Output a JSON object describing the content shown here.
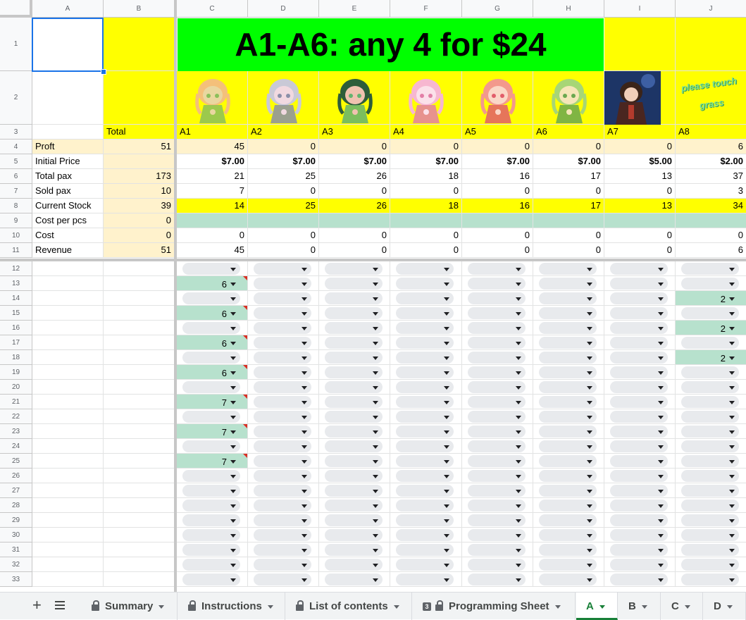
{
  "columns": [
    "A",
    "B",
    "C",
    "D",
    "E",
    "F",
    "G",
    "H",
    "I",
    "J"
  ],
  "banner": "A1-A6: any 4 for $24",
  "header_row": {
    "total": "Total",
    "items": [
      "A1",
      "A2",
      "A3",
      "A4",
      "A5",
      "A6",
      "A7",
      "A8"
    ]
  },
  "rows": [
    {
      "num": "4",
      "label": "Proft",
      "total": "51",
      "values": [
        "45",
        "0",
        "0",
        "0",
        "0",
        "0",
        "0",
        "6"
      ]
    },
    {
      "num": "5",
      "label": "Initial Price",
      "total": "",
      "values": [
        "$7.00",
        "$7.00",
        "$7.00",
        "$7.00",
        "$7.00",
        "$7.00",
        "$5.00",
        "$2.00"
      ]
    },
    {
      "num": "6",
      "label": "Total pax",
      "total": "173",
      "values": [
        "21",
        "25",
        "26",
        "18",
        "16",
        "17",
        "13",
        "37"
      ]
    },
    {
      "num": "7",
      "label": "Sold pax",
      "total": "10",
      "values": [
        "7",
        "0",
        "0",
        "0",
        "0",
        "0",
        "0",
        "3"
      ]
    },
    {
      "num": "8",
      "label": "Current Stock",
      "total": "39",
      "values": [
        "14",
        "25",
        "26",
        "18",
        "16",
        "17",
        "13",
        "34"
      ]
    },
    {
      "num": "9",
      "label": "Cost per pcs",
      "total": "0",
      "values": [
        "",
        "",
        "",
        "",
        "",
        "",
        "",
        ""
      ]
    },
    {
      "num": "10",
      "label": "Cost",
      "total": "0",
      "values": [
        "0",
        "0",
        "0",
        "0",
        "0",
        "0",
        "0",
        "0"
      ]
    },
    {
      "num": "11",
      "label": "Revenue",
      "total": "51",
      "values": [
        "45",
        "0",
        "0",
        "0",
        "0",
        "0",
        "0",
        "6"
      ]
    }
  ],
  "row_numbers_top": [
    "1",
    "2",
    "3"
  ],
  "dropdown_rows": [
    "12",
    "13",
    "14",
    "15",
    "16",
    "17",
    "18",
    "19",
    "20",
    "21",
    "22",
    "23",
    "24",
    "25",
    "26",
    "27",
    "28",
    "29",
    "30",
    "31",
    "32",
    "33"
  ],
  "dropdown_values": {
    "C": {
      "13": "6",
      "15": "6",
      "17": "6",
      "19": "6",
      "21": "7",
      "23": "7",
      "25": "7"
    },
    "J": {
      "14": "2",
      "16": "2",
      "18": "2"
    }
  },
  "image_text_j2": "please touch grass",
  "tabs": [
    {
      "label": "Summary",
      "locked": true,
      "badge": ""
    },
    {
      "label": "Instructions",
      "locked": true,
      "badge": ""
    },
    {
      "label": "List of contents",
      "locked": true,
      "badge": ""
    },
    {
      "label": "Programming Sheet",
      "locked": true,
      "badge": "3"
    },
    {
      "label": "A",
      "locked": false,
      "badge": "",
      "active": true
    },
    {
      "label": "B",
      "locked": false,
      "badge": ""
    },
    {
      "label": "C",
      "locked": false,
      "badge": ""
    },
    {
      "label": "D",
      "locked": false,
      "badge": ""
    }
  ],
  "colors": {
    "yellow": "#ffff00",
    "light_orange": "#fff2cc",
    "green_banner": "#00ff00",
    "green_cell": "#b7e1cd"
  }
}
